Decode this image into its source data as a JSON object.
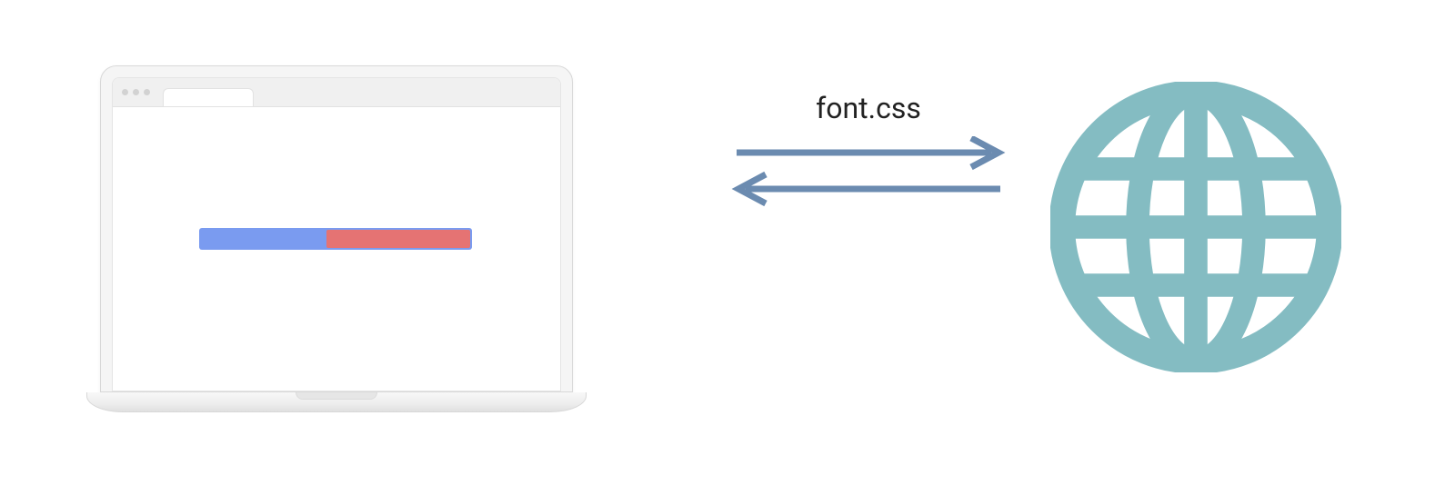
{
  "diagram": {
    "request_label": "font.css",
    "laptop": {
      "progress_color_bg": "#7a9bf0",
      "progress_color_fill": "#e57373"
    },
    "arrow_color": "#6b8bb0",
    "globe_color": "#84bcc2"
  }
}
